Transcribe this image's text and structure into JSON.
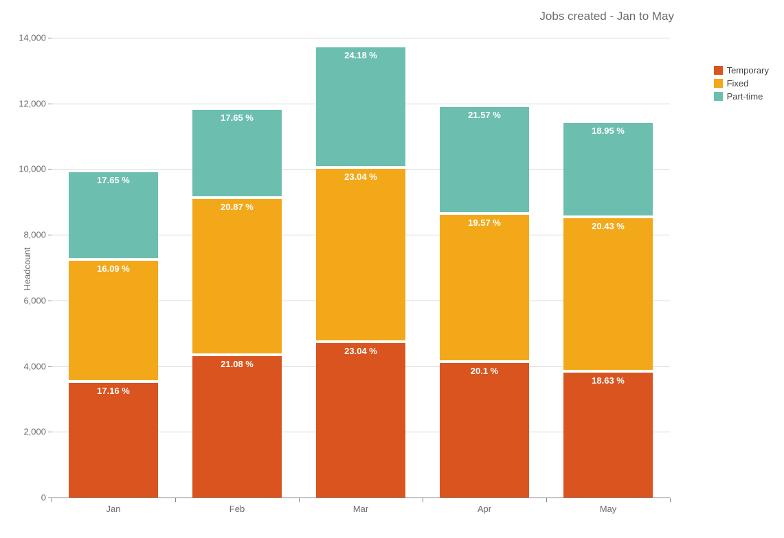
{
  "chart_data": {
    "type": "bar",
    "stacked": true,
    "title": "Jobs created - Jan to May",
    "ylabel": "Headcount",
    "xlabel": "",
    "ylim": [
      0,
      14000
    ],
    "yticks": [
      0,
      2000,
      4000,
      6000,
      8000,
      10000,
      12000,
      14000
    ],
    "ytick_labels": [
      "0",
      "2,000",
      "4,000",
      "6,000",
      "8,000",
      "10,000",
      "12,000",
      "14,000"
    ],
    "categories": [
      "Jan",
      "Feb",
      "Mar",
      "Apr",
      "May"
    ],
    "series": [
      {
        "name": "Temporary",
        "color": "#d9541e",
        "values": [
          3500,
          4300,
          4700,
          4100,
          3800
        ],
        "labels": [
          "17.16 %",
          "21.08 %",
          "23.04 %",
          "20.1 %",
          "18.63 %"
        ]
      },
      {
        "name": "Fixed",
        "color": "#f3a81a",
        "values": [
          3700,
          4800,
          5300,
          4500,
          4700
        ],
        "labels": [
          "16.09 %",
          "20.87 %",
          "23.04 %",
          "19.57 %",
          "20.43 %"
        ]
      },
      {
        "name": "Part-time",
        "color": "#6cbfaf",
        "values": [
          2700,
          2700,
          3700,
          3300,
          2900
        ],
        "labels": [
          "17.65 %",
          "17.65 %",
          "24.18 %",
          "21.57 %",
          "18.95 %"
        ]
      }
    ]
  }
}
